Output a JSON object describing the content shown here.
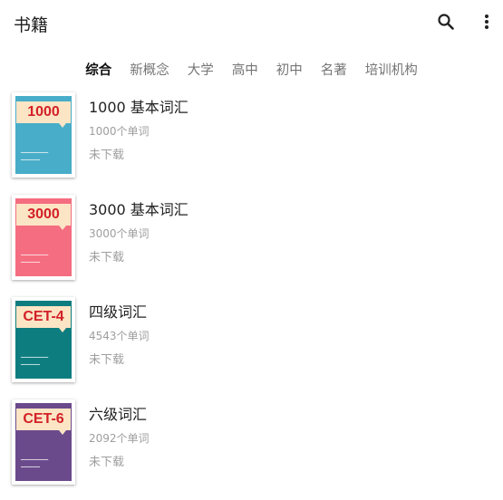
{
  "appbar": {
    "title": "书籍",
    "search_icon": "search-icon",
    "more_icon": "more-vert-icon"
  },
  "tabs": [
    {
      "label": "综合",
      "active": true
    },
    {
      "label": "新概念",
      "active": false
    },
    {
      "label": "大学",
      "active": false
    },
    {
      "label": "高中",
      "active": false
    },
    {
      "label": "初中",
      "active": false
    },
    {
      "label": "名著",
      "active": false
    },
    {
      "label": "培训机构",
      "active": false
    }
  ],
  "books": [
    {
      "cover_label": "1000",
      "cover_color": "#48adc8",
      "name": "1000 基本词汇",
      "count": "1000个单词",
      "status": "未下载"
    },
    {
      "cover_label": "3000",
      "cover_color": "#f56d80",
      "name": "3000 基本词汇",
      "count": "3000个单词",
      "status": "未下载"
    },
    {
      "cover_label": "CET-4",
      "cover_color": "#0e7d80",
      "name": "四级词汇",
      "count": "4543个单词",
      "status": "未下载"
    },
    {
      "cover_label": "CET-6",
      "cover_color": "#6b4a8c",
      "name": "六级词汇",
      "count": "2092个单词",
      "status": "未下载"
    }
  ],
  "colors": {
    "cover_band": "#fbe5c5",
    "cover_text": "#d32027",
    "text_primary": "#212121",
    "text_secondary": "#9e9e9e"
  }
}
